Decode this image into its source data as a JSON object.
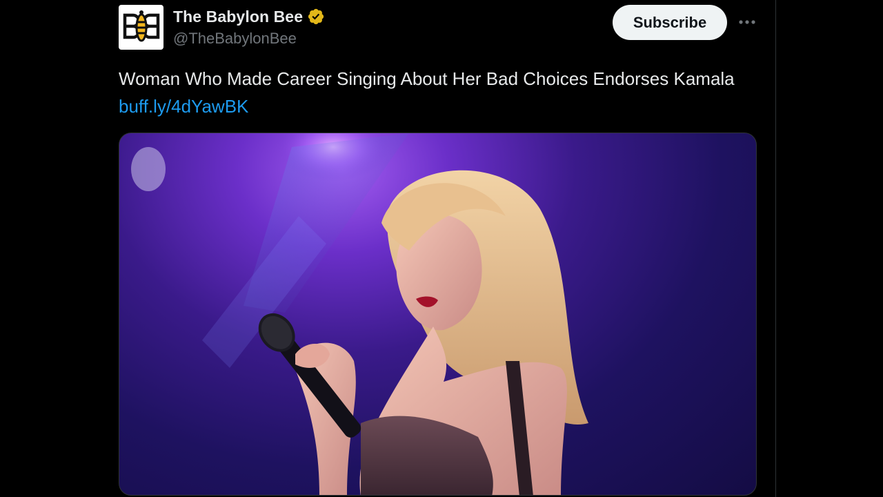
{
  "tweet": {
    "author": {
      "display_name": "The Babylon Bee",
      "handle": "@TheBabylonBee",
      "avatar_icon": "babylon-bee-logo-icon",
      "verified_icon": "verified-gold-badge-icon"
    },
    "subscribe_label": "Subscribe",
    "more_icon": "more-options-icon",
    "text": "Woman Who Made Career Singing About Her Bad Choices Endorses Kamala",
    "link": "buff.ly/4dYawBK",
    "media_alt": "photo"
  },
  "colors": {
    "background": "#000000",
    "text_primary": "#e7e9ea",
    "text_secondary": "#71767b",
    "link": "#1d9bf0",
    "verified_gold": "#e2b719",
    "subscribe_bg": "#eff3f4"
  }
}
